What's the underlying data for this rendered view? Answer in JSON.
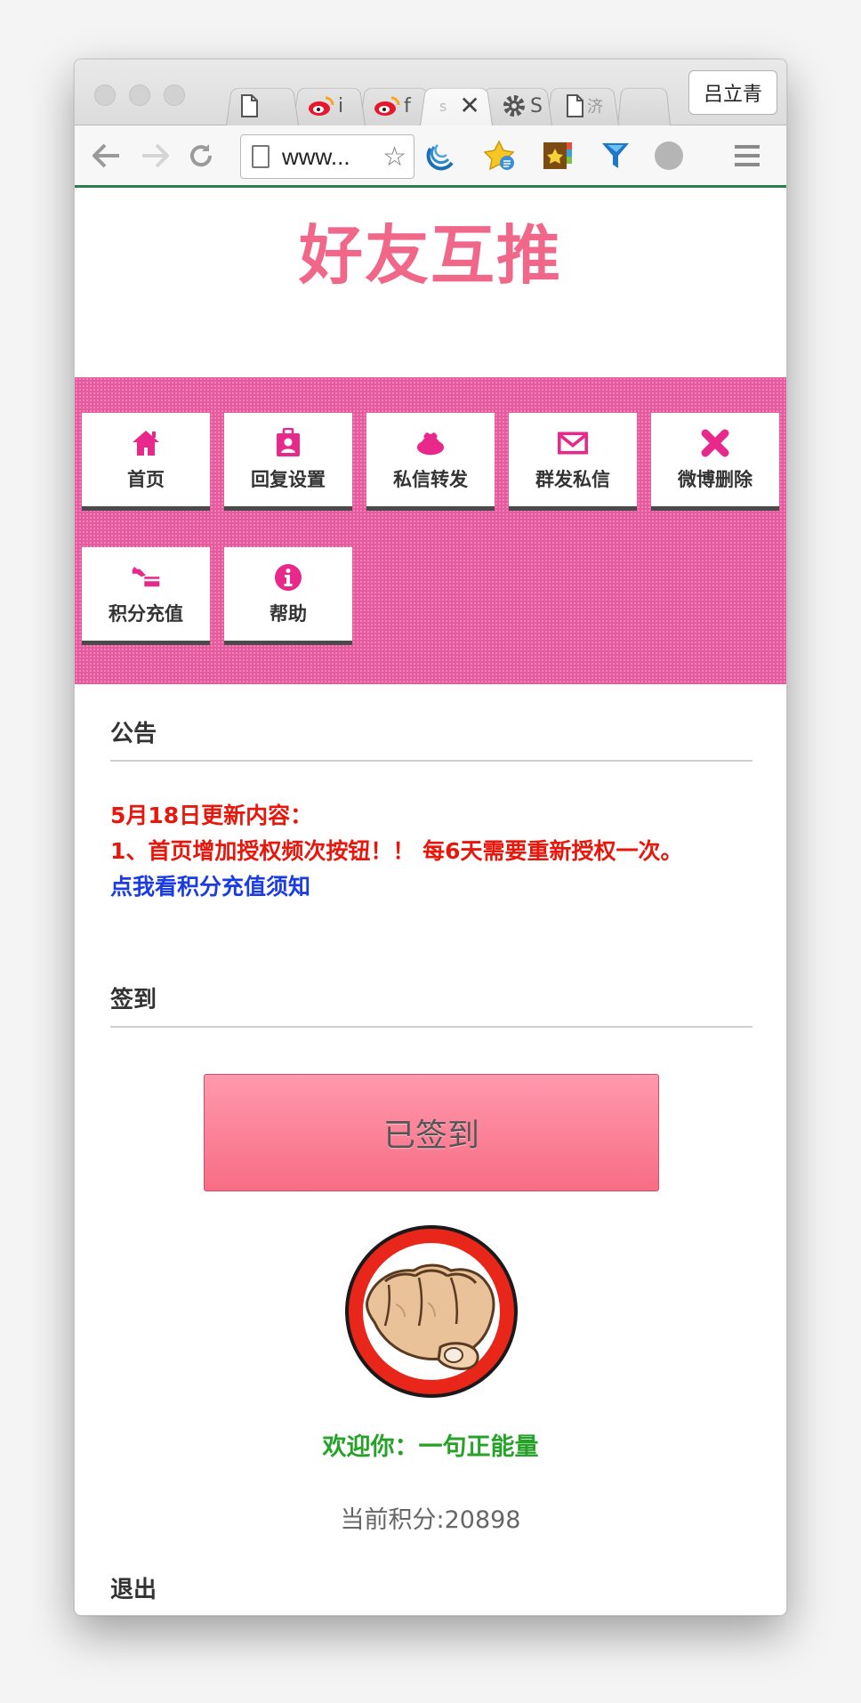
{
  "browser": {
    "tabs": [
      {
        "icon": "page-icon",
        "label": ""
      },
      {
        "icon": "weibo-icon",
        "label": "i"
      },
      {
        "icon": "weibo-icon",
        "label": "f"
      },
      {
        "icon": "page-icon",
        "label": "s",
        "close": "✕"
      },
      {
        "icon": "gear-icon",
        "label": "S"
      },
      {
        "icon": "page-icon",
        "label": "济"
      },
      {
        "icon": "new-tab",
        "label": ""
      }
    ],
    "profile_name": "吕立青",
    "url": "www...",
    "accent_color": "#2e7d4f"
  },
  "site": {
    "title": "好友互推",
    "title_color": "#f0678a",
    "panel_color": "#e8599f",
    "menu": [
      {
        "label": "首页",
        "icon": "home-icon"
      },
      {
        "label": "回复设置",
        "icon": "contact-card-icon"
      },
      {
        "label": "私信转发",
        "icon": "purse-icon"
      },
      {
        "label": "群发私信",
        "icon": "envelope-icon"
      },
      {
        "label": "微博删除",
        "icon": "cross-icon"
      },
      {
        "label": "积分充值",
        "icon": "hand-card-icon"
      },
      {
        "label": "帮助",
        "icon": "info-icon"
      }
    ]
  },
  "announcement": {
    "heading": "公告",
    "line1": "5月18日更新内容：",
    "line2": "1、首页增加授权频次按钮！！ 每6天需要重新授权一次。",
    "link": "点我看积分充值须知"
  },
  "signin": {
    "heading": "签到",
    "button": "已签到"
  },
  "user": {
    "welcome": "欢迎你：一句正能量",
    "points": "当前积分:20898"
  },
  "logout": {
    "heading": "退出"
  }
}
